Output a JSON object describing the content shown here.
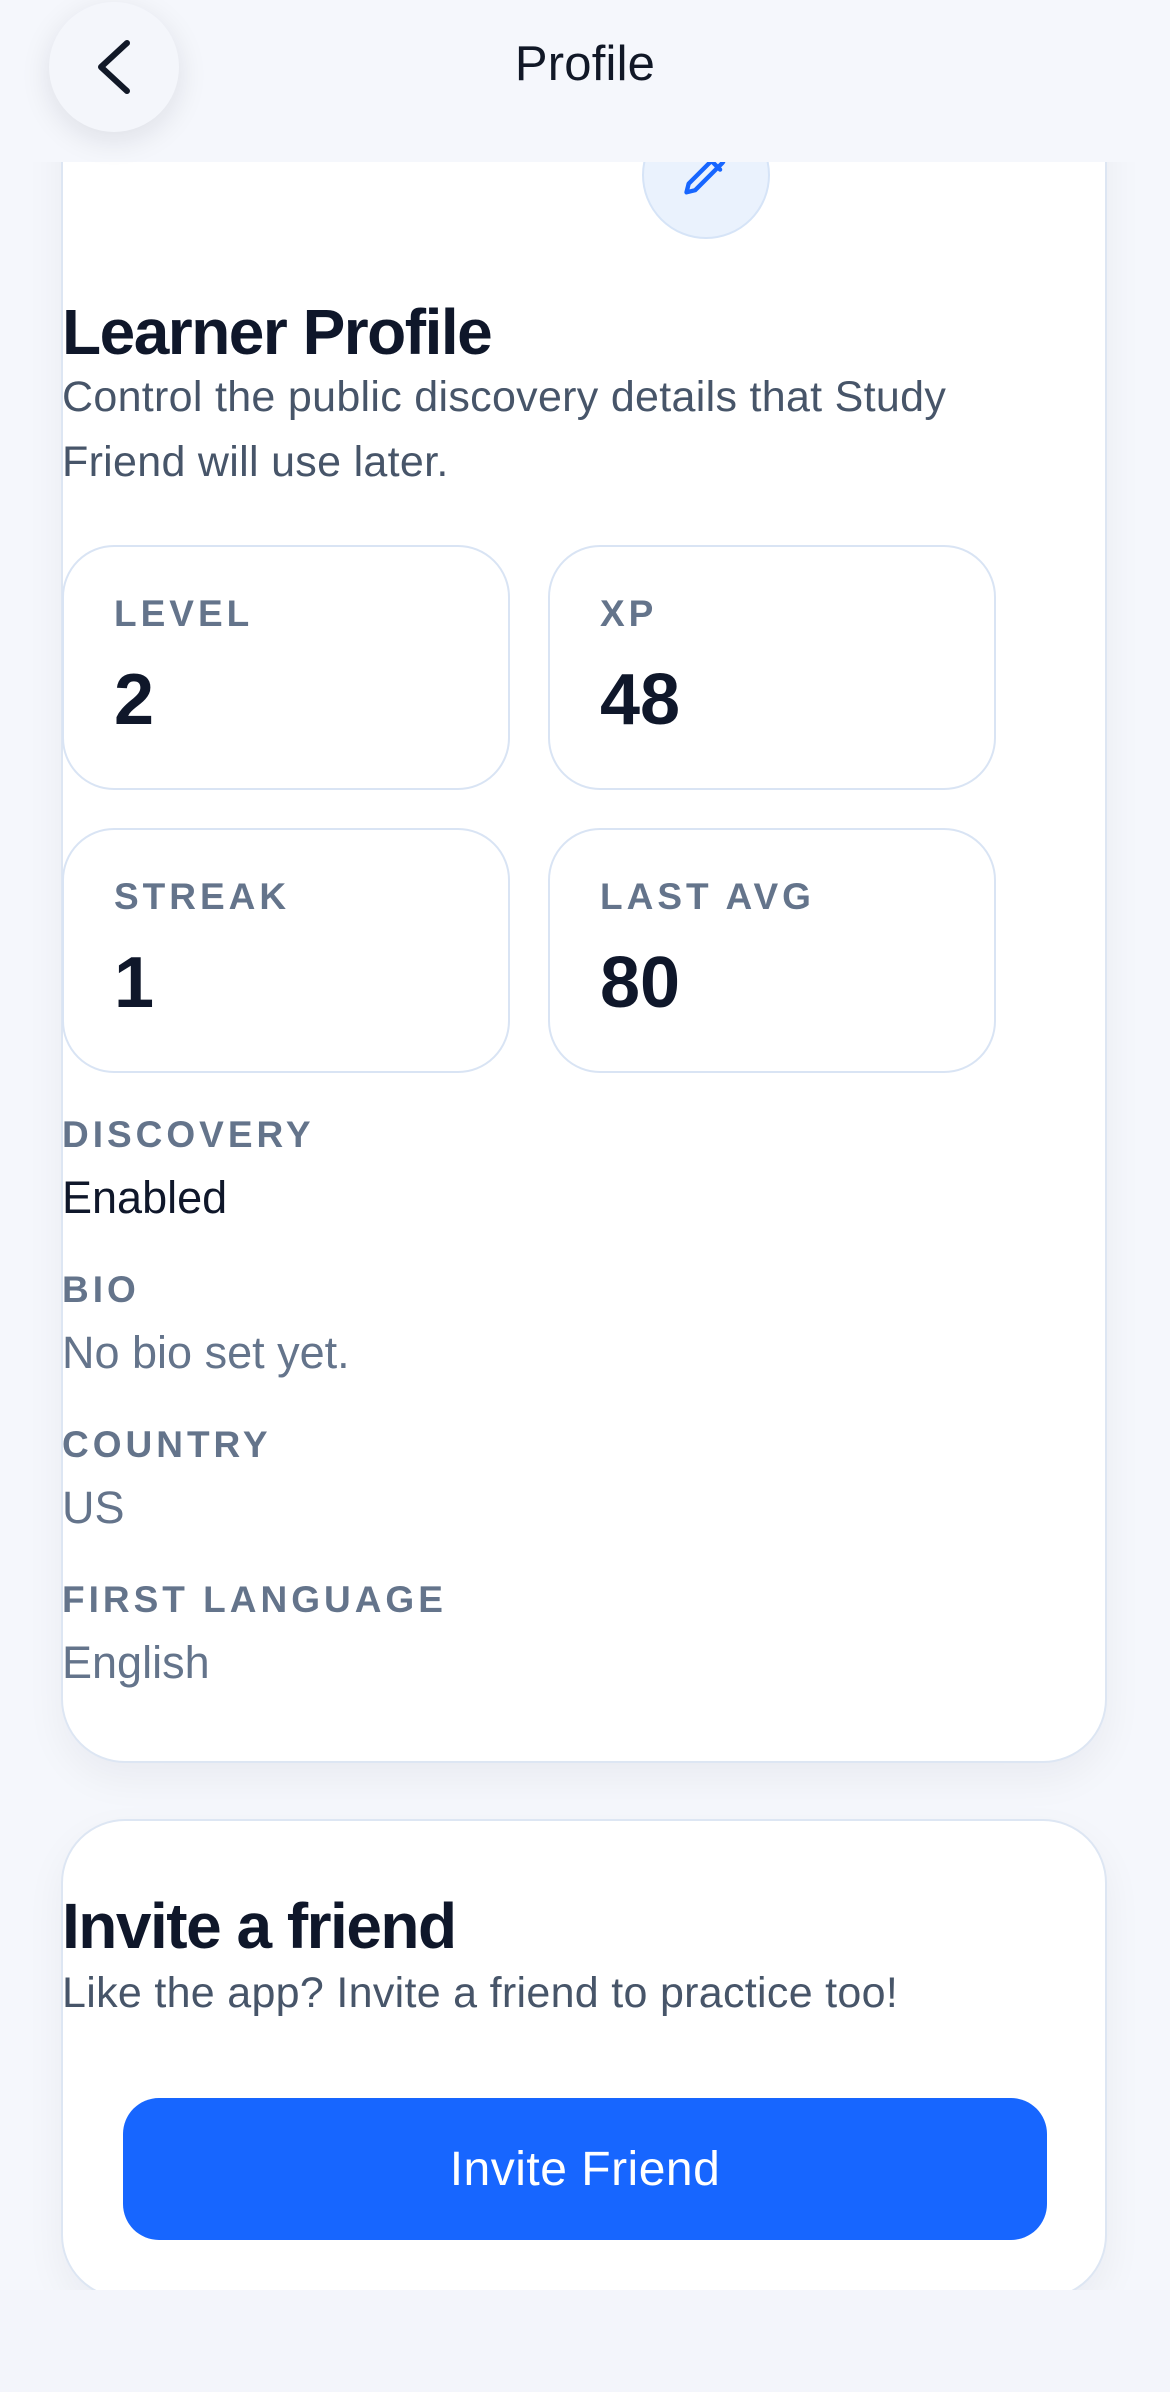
{
  "header": {
    "title": "Profile",
    "back_icon": "chevron-left-icon"
  },
  "profile_card": {
    "heading": "Learner Profile",
    "edit_icon": "pencil-icon",
    "subtitle": "Control the public discovery details that Study Friend will use later.",
    "stats": {
      "level": {
        "label": "LEVEL",
        "value": "2"
      },
      "xp": {
        "label": "XP",
        "value": "48"
      },
      "streak": {
        "label": "STREAK",
        "value": "1"
      },
      "last_avg": {
        "label": "LAST AVG",
        "value": "80"
      }
    },
    "fields": {
      "discovery": {
        "label": "DISCOVERY",
        "value": "Enabled"
      },
      "bio": {
        "label": "BIO",
        "value": "No bio set yet."
      },
      "country": {
        "label": "COUNTRY",
        "value": "US"
      },
      "first_language": {
        "label": "FIRST LANGUAGE",
        "value": "English"
      }
    }
  },
  "invite_card": {
    "heading": "Invite a friend",
    "subtitle": "Like the app? Invite a friend to practice too!",
    "button_label": "Invite Friend"
  },
  "colors": {
    "accent": "#1766ff",
    "background": "#f5f7fc",
    "card": "#ffffff",
    "text_primary": "#0f172a",
    "text_muted": "#64748b"
  }
}
